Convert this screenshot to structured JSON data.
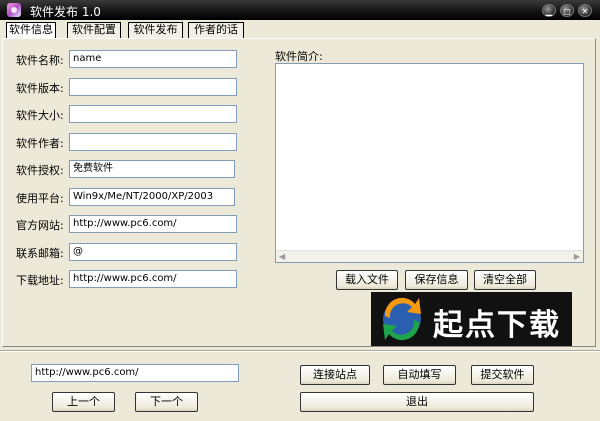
{
  "window": {
    "title": "软件发布 1.0"
  },
  "tabs": [
    "软件信息",
    "软件配置",
    "软件发布",
    "作者的话"
  ],
  "form": {
    "name": {
      "label": "软件名称:",
      "value": "name"
    },
    "version": {
      "label": "软件版本:",
      "value": ""
    },
    "size": {
      "label": "软件大小:",
      "value": ""
    },
    "author": {
      "label": "软件作者:",
      "value": ""
    },
    "license": {
      "label": "软件授权:",
      "value": "免费软件"
    },
    "platform": {
      "label": "使用平台:",
      "value": "Win9x/Me/NT/2000/XP/2003"
    },
    "website": {
      "label": "官方网站:",
      "value": "http://www.pc6.com/"
    },
    "email": {
      "label": "联系邮箱:",
      "value": "@"
    },
    "download": {
      "label": "下载地址:",
      "value": "http://www.pc6.com/"
    }
  },
  "intro": {
    "label": "软件简介:",
    "value": ""
  },
  "intro_buttons": {
    "load": "载入文件",
    "save": "保存信息",
    "clear": "清空全部"
  },
  "logo": {
    "text": "起点下载"
  },
  "bottom": {
    "url": "http://www.pc6.com/",
    "connect": "连接站点",
    "autofill": "自动填写",
    "submit": "提交软件",
    "prev": "上一个",
    "next": "下一个",
    "exit": "退出"
  }
}
